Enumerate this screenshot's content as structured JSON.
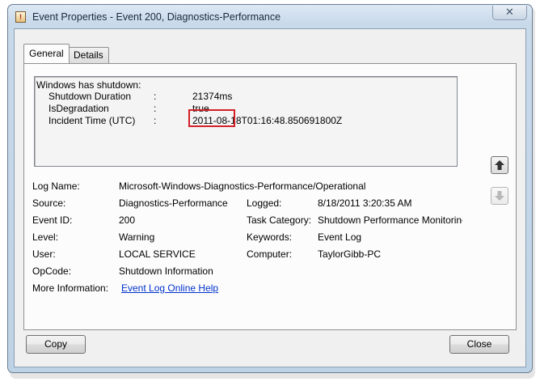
{
  "window": {
    "title": "Event Properties - Event 200, Diagnostics-Performance",
    "close_glyph": "✕"
  },
  "tabs": [
    {
      "label": "General",
      "active": true
    },
    {
      "label": "Details",
      "active": false
    }
  ],
  "description": {
    "heading": "Windows has shutdown:",
    "rows": [
      {
        "label": "Shutdown Duration",
        "sep": ":",
        "value": "21374ms",
        "highlighted": true
      },
      {
        "label": "IsDegradation",
        "sep": ":",
        "value": "true"
      },
      {
        "label": "Incident Time (UTC)",
        "sep": ":",
        "value": "2011-08-18T01:16:48.850691800Z"
      }
    ]
  },
  "fields": {
    "log_name": {
      "label": "Log Name:",
      "value": "Microsoft-Windows-Diagnostics-Performance/Operational"
    },
    "source": {
      "label": "Source:",
      "value": "Diagnostics-Performance"
    },
    "logged": {
      "label": "Logged:",
      "value": "8/18/2011 3:20:35 AM"
    },
    "event_id": {
      "label": "Event ID:",
      "value": "200"
    },
    "task_category": {
      "label": "Task Category:",
      "value": "Shutdown Performance Monitoring"
    },
    "level": {
      "label": "Level:",
      "value": "Warning"
    },
    "keywords": {
      "label": "Keywords:",
      "value": "Event Log"
    },
    "user": {
      "label": "User:",
      "value": "LOCAL SERVICE"
    },
    "computer": {
      "label": "Computer:",
      "value": "TaylorGibb-PC"
    },
    "opcode": {
      "label": "OpCode:",
      "value": "Shutdown Information"
    },
    "more_info": {
      "label": "More Information:",
      "value": "Event Log Online Help"
    }
  },
  "buttons": {
    "copy": "Copy",
    "close": "Close"
  },
  "icons": {
    "app": "event-viewer-icon",
    "up": "arrow-up-icon",
    "down": "arrow-down-icon"
  },
  "colors": {
    "highlight_box": "#d21f26",
    "link": "#0033cc"
  }
}
